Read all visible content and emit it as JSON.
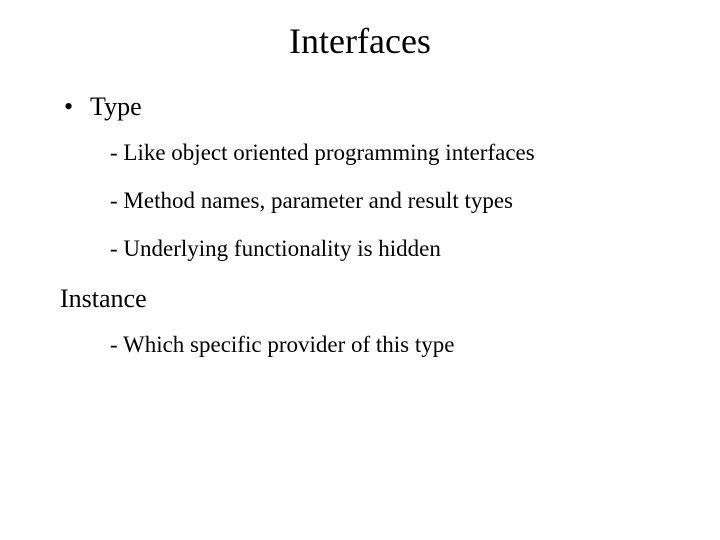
{
  "title": "Interfaces",
  "bullet1": {
    "marker": "•",
    "label": "Type",
    "subs": {
      "a": "- Like object oriented programming interfaces",
      "b": "- Method names, parameter and result types",
      "c": "- Underlying functionality is hidden"
    }
  },
  "instance": {
    "label": "Instance",
    "subs": {
      "a": "- Which specific provider of this type"
    }
  }
}
